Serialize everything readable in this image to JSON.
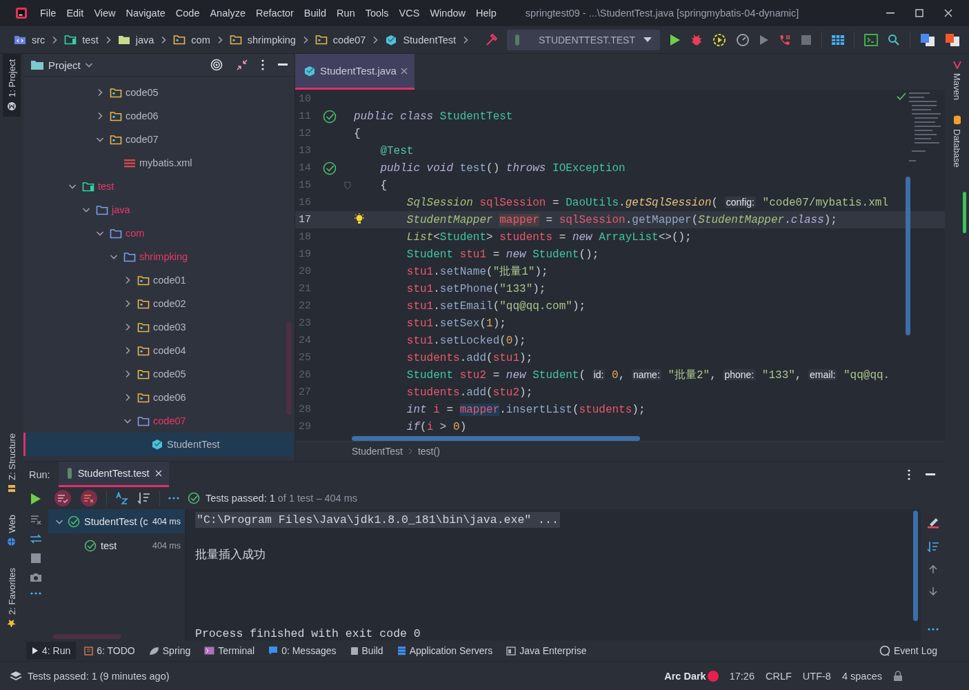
{
  "window": {
    "title": "springtest09 - ...\\StudentTest.java [springmybatis-04-dynamic]"
  },
  "menu": [
    "File",
    "Edit",
    "View",
    "Navigate",
    "Code",
    "Analyze",
    "Refactor",
    "Build",
    "Run",
    "Tools",
    "VCS",
    "Window",
    "Help"
  ],
  "nav": {
    "breadcrumb": [
      {
        "label": "src",
        "kind": "source_root"
      },
      {
        "label": "test",
        "kind": "test_root"
      },
      {
        "label": "java",
        "kind": "java_root"
      },
      {
        "label": "com",
        "kind": "package"
      },
      {
        "label": "shrimpking",
        "kind": "package"
      },
      {
        "label": "code07",
        "kind": "package"
      },
      {
        "label": "StudentTest",
        "kind": "class"
      }
    ],
    "run_config": "STUDENTTEST.TEST"
  },
  "left_stripe": {
    "top": [
      {
        "label": "1: Project",
        "selected": true
      }
    ],
    "bottom": [
      {
        "label": "Z: Structure",
        "selected": false
      },
      {
        "label": "Web",
        "selected": false
      },
      {
        "label": "2: Favorites",
        "selected": false
      }
    ]
  },
  "right_stripe": [
    "Maven",
    "Database"
  ],
  "project": {
    "title": "Project",
    "tree": [
      {
        "children": [
          {
            "children": [
              {
                "children": [
                  {
                    "label": "code05",
                    "kind": "package",
                    "expanded": false,
                    "unversioned": false,
                    "selected": false
                  },
                  {
                    "label": "code06",
                    "kind": "package",
                    "expanded": false,
                    "unversioned": false,
                    "selected": false
                  },
                  {
                    "label": "code07",
                    "kind": "package",
                    "expanded": true,
                    "unversioned": false,
                    "selected": false,
                    "children": [
                      {
                        "label": "mybatis.xml",
                        "kind": "xml",
                        "unversioned": false,
                        "selected": false
                      }
                    ]
                  }
                ]
              }
            ]
          },
          {
            "label": "test",
            "kind": "test_root",
            "expanded": true,
            "unversioned": true,
            "selected": false,
            "children": [
              {
                "label": "java",
                "kind": "folder",
                "expanded": true,
                "unversioned": true,
                "selected": false,
                "children": [
                  {
                    "label": "com",
                    "kind": "folder",
                    "expanded": true,
                    "unversioned": true,
                    "selected": false,
                    "children": [
                      {
                        "label": "shrimpking",
                        "kind": "folder",
                        "expanded": true,
                        "unversioned": true,
                        "selected": false,
                        "children": [
                          {
                            "label": "code01",
                            "kind": "package",
                            "expanded": false,
                            "unversioned": false,
                            "selected": false
                          },
                          {
                            "label": "code02",
                            "kind": "package",
                            "expanded": false,
                            "unversioned": false,
                            "selected": false
                          },
                          {
                            "label": "code03",
                            "kind": "package",
                            "expanded": false,
                            "unversioned": false,
                            "selected": false
                          },
                          {
                            "label": "code04",
                            "kind": "package",
                            "expanded": false,
                            "unversioned": false,
                            "selected": false
                          },
                          {
                            "label": "code05",
                            "kind": "package",
                            "expanded": false,
                            "unversioned": false,
                            "selected": false
                          },
                          {
                            "label": "code06",
                            "kind": "package",
                            "expanded": false,
                            "unversioned": false,
                            "selected": false
                          },
                          {
                            "label": "code07",
                            "kind": "folder",
                            "expanded": true,
                            "unversioned": true,
                            "selected": false,
                            "children": [
                              {
                                "label": "StudentTest",
                                "kind": "class",
                                "unversioned": false,
                                "selected": true
                              }
                            ]
                          }
                        ]
                      }
                    ]
                  }
                ]
              }
            ]
          }
        ]
      }
    ]
  },
  "editor": {
    "tabs": [
      {
        "label": "StudentTest.java",
        "selected": true
      }
    ],
    "lines": [
      {
        "number": "10",
        "kind": "plain",
        "current": false
      },
      {
        "number": "11",
        "kind": "runnable",
        "current": false,
        "tokens": [
          {
            "kind": "kw",
            "text": "public class "
          },
          {
            "kind": "type",
            "text": "StudentTest"
          }
        ]
      },
      {
        "number": "12",
        "kind": "plain",
        "current": false,
        "tokens": [
          {
            "kind": "punct",
            "text": "{"
          }
        ]
      },
      {
        "number": "13",
        "kind": "plain",
        "current": false,
        "tokens": [
          {
            "kind": "annotation",
            "text": "    @Test"
          }
        ]
      },
      {
        "number": "14",
        "kind": "runnable",
        "current": false,
        "tokens": [
          {
            "kind": "kw",
            "text": "    public void "
          },
          {
            "kind": "method",
            "text": "test"
          },
          {
            "kind": "punct",
            "text": "() "
          },
          {
            "kind": "kw",
            "text": "throws "
          },
          {
            "kind": "type",
            "text": "IOException"
          }
        ]
      },
      {
        "number": "15",
        "kind": "foldable",
        "current": false,
        "tokens": [
          {
            "kind": "punct",
            "text": "    {"
          }
        ]
      },
      {
        "number": "16",
        "kind": "plain",
        "current": false,
        "tokens": [
          {
            "kind": "itype",
            "text": "        SqlSession "
          },
          {
            "kind": "var",
            "text": "sqlSession"
          },
          {
            "kind": "punct",
            "text": " = "
          },
          {
            "kind": "type",
            "text": "DaoUtils"
          },
          {
            "kind": "punct",
            "text": "."
          },
          {
            "kind": "static",
            "text": "getSqlSession"
          },
          {
            "kind": "punct",
            "text": "( "
          },
          {
            "kind": "hint",
            "text": "config:"
          },
          {
            "kind": "string",
            "text": " \"code07/mybatis.xml"
          }
        ]
      },
      {
        "number": "17",
        "kind": "intention",
        "current": true,
        "tokens": [
          {
            "kind": "itype",
            "text": "        StudentMapper "
          },
          {
            "kind": "var_write",
            "text": "mapper"
          },
          {
            "kind": "punct",
            "text": " = "
          },
          {
            "kind": "var",
            "text": "sqlSession"
          },
          {
            "kind": "punct",
            "text": "."
          },
          {
            "kind": "method",
            "text": "getMapper"
          },
          {
            "kind": "punct",
            "text": "("
          },
          {
            "kind": "itype",
            "text": "StudentMapper"
          },
          {
            "kind": "punct",
            "text": "."
          },
          {
            "kind": "kw",
            "text": "class"
          },
          {
            "kind": "punct",
            "text": ");"
          }
        ]
      },
      {
        "number": "18",
        "kind": "plain",
        "current": false,
        "tokens": [
          {
            "kind": "itype",
            "text": "        List"
          },
          {
            "kind": "punct",
            "text": "<"
          },
          {
            "kind": "type",
            "text": "Student"
          },
          {
            "kind": "punct",
            "text": "> "
          },
          {
            "kind": "var",
            "text": "students"
          },
          {
            "kind": "punct",
            "text": " = "
          },
          {
            "kind": "kw",
            "text": "new "
          },
          {
            "kind": "type",
            "text": "ArrayList"
          },
          {
            "kind": "punct",
            "text": "<>();"
          }
        ]
      },
      {
        "number": "19",
        "kind": "plain",
        "current": false,
        "tokens": [
          {
            "kind": "type",
            "text": "        Student "
          },
          {
            "kind": "var",
            "text": "stu1"
          },
          {
            "kind": "punct",
            "text": " = "
          },
          {
            "kind": "kw",
            "text": "new "
          },
          {
            "kind": "type",
            "text": "Student"
          },
          {
            "kind": "punct",
            "text": "();"
          }
        ]
      },
      {
        "number": "20",
        "kind": "plain",
        "current": false,
        "tokens": [
          {
            "kind": "var",
            "text": "        stu1"
          },
          {
            "kind": "punct",
            "text": "."
          },
          {
            "kind": "method",
            "text": "setName"
          },
          {
            "kind": "punct",
            "text": "("
          },
          {
            "kind": "string",
            "text": "\"批量1\""
          },
          {
            "kind": "punct",
            "text": ");"
          }
        ]
      },
      {
        "number": "21",
        "kind": "plain",
        "current": false,
        "tokens": [
          {
            "kind": "var",
            "text": "        stu1"
          },
          {
            "kind": "punct",
            "text": "."
          },
          {
            "kind": "method",
            "text": "setPhone"
          },
          {
            "kind": "punct",
            "text": "("
          },
          {
            "kind": "string",
            "text": "\"133\""
          },
          {
            "kind": "punct",
            "text": ");"
          }
        ]
      },
      {
        "number": "22",
        "kind": "plain",
        "current": false,
        "tokens": [
          {
            "kind": "var",
            "text": "        stu1"
          },
          {
            "kind": "punct",
            "text": "."
          },
          {
            "kind": "method",
            "text": "setEmail"
          },
          {
            "kind": "punct",
            "text": "("
          },
          {
            "kind": "string",
            "text": "\"qq@qq.com\""
          },
          {
            "kind": "punct",
            "text": ");"
          }
        ]
      },
      {
        "number": "23",
        "kind": "plain",
        "current": false,
        "tokens": [
          {
            "kind": "var",
            "text": "        stu1"
          },
          {
            "kind": "punct",
            "text": "."
          },
          {
            "kind": "method",
            "text": "setSex"
          },
          {
            "kind": "punct",
            "text": "("
          },
          {
            "kind": "number",
            "text": "1"
          },
          {
            "kind": "punct",
            "text": ");"
          }
        ]
      },
      {
        "number": "24",
        "kind": "plain",
        "current": false,
        "tokens": [
          {
            "kind": "var",
            "text": "        stu1"
          },
          {
            "kind": "punct",
            "text": "."
          },
          {
            "kind": "method",
            "text": "setLocked"
          },
          {
            "kind": "punct",
            "text": "("
          },
          {
            "kind": "number",
            "text": "0"
          },
          {
            "kind": "punct",
            "text": ");"
          }
        ]
      },
      {
        "number": "25",
        "kind": "plain",
        "current": false,
        "tokens": [
          {
            "kind": "var",
            "text": "        students"
          },
          {
            "kind": "punct",
            "text": "."
          },
          {
            "kind": "method",
            "text": "add"
          },
          {
            "kind": "punct",
            "text": "("
          },
          {
            "kind": "var",
            "text": "stu1"
          },
          {
            "kind": "punct",
            "text": ");"
          }
        ]
      },
      {
        "number": "26",
        "kind": "plain",
        "current": false,
        "tokens": [
          {
            "kind": "type",
            "text": "        Student "
          },
          {
            "kind": "var",
            "text": "stu2"
          },
          {
            "kind": "punct",
            "text": " = "
          },
          {
            "kind": "kw",
            "text": "new "
          },
          {
            "kind": "type",
            "text": "Student"
          },
          {
            "kind": "punct",
            "text": "( "
          },
          {
            "kind": "hint",
            "text": "id:"
          },
          {
            "kind": "number",
            "text": " 0"
          },
          {
            "kind": "punct",
            "text": ", "
          },
          {
            "kind": "hint",
            "text": "name:"
          },
          {
            "kind": "string",
            "text": " \"批量2\""
          },
          {
            "kind": "punct",
            "text": ", "
          },
          {
            "kind": "hint",
            "text": "phone:"
          },
          {
            "kind": "string",
            "text": " \"133\""
          },
          {
            "kind": "punct",
            "text": ", "
          },
          {
            "kind": "hint",
            "text": "email:"
          },
          {
            "kind": "string",
            "text": " \"qq@qq."
          }
        ]
      },
      {
        "number": "27",
        "kind": "plain",
        "current": false,
        "tokens": [
          {
            "kind": "var",
            "text": "        students"
          },
          {
            "kind": "punct",
            "text": "."
          },
          {
            "kind": "method",
            "text": "add"
          },
          {
            "kind": "punct",
            "text": "("
          },
          {
            "kind": "var",
            "text": "stu2"
          },
          {
            "kind": "punct",
            "text": ");"
          }
        ]
      },
      {
        "number": "28",
        "kind": "plain",
        "current": false,
        "tokens": [
          {
            "kind": "kw",
            "text": "        int "
          },
          {
            "kind": "var",
            "text": "i"
          },
          {
            "kind": "punct",
            "text": " = "
          },
          {
            "kind": "var_read",
            "text": "mapper"
          },
          {
            "kind": "punct",
            "text": "."
          },
          {
            "kind": "method",
            "text": "insertList"
          },
          {
            "kind": "punct",
            "text": "("
          },
          {
            "kind": "var",
            "text": "students"
          },
          {
            "kind": "punct",
            "text": ");"
          }
        ]
      },
      {
        "number": "29",
        "kind": "plain",
        "current": false,
        "tokens": [
          {
            "kind": "kw",
            "text": "        if"
          },
          {
            "kind": "punct",
            "text": "("
          },
          {
            "kind": "var",
            "text": "i"
          },
          {
            "kind": "punct",
            "text": " > "
          },
          {
            "kind": "number",
            "text": "0"
          },
          {
            "kind": "punct",
            "text": ")"
          }
        ]
      }
    ],
    "breadcrumb": [
      "StudentTest",
      "test()"
    ]
  },
  "run": {
    "label": "Run:",
    "tab": {
      "label": "StudentTest.test",
      "selected": true
    },
    "status": "Tests passed: 1",
    "status_detail": "of 1 test – 404 ms",
    "tests": [
      {
        "label": "StudentTest (c",
        "duration": "404 ms",
        "selected": true,
        "children": [
          {
            "label": "test",
            "duration": "404 ms",
            "selected": false
          }
        ]
      }
    ],
    "console": [
      {
        "kind": "command",
        "text": "\"C:\\Program Files\\Java\\jdk1.8.0_181\\bin\\java.exe\" ..."
      },
      {
        "kind": "output",
        "text": "批量插入成功"
      },
      {
        "kind": "exit",
        "text": "Process finished with exit code 0"
      }
    ]
  },
  "tool_windows": [
    {
      "label": "4: Run",
      "kind": "run",
      "selected": true
    },
    {
      "label": "6: TODO",
      "kind": "todo",
      "selected": false
    },
    {
      "label": "Spring",
      "kind": "spring",
      "selected": false
    },
    {
      "label": "Terminal",
      "kind": "terminal",
      "selected": false
    },
    {
      "label": "0: Messages",
      "kind": "messages",
      "selected": false
    },
    {
      "label": "Build",
      "kind": "build",
      "selected": false
    },
    {
      "label": "Application Servers",
      "kind": "servers",
      "selected": false
    },
    {
      "label": "Java Enterprise",
      "kind": "enterprise",
      "selected": false
    }
  ],
  "event_log": "Event Log",
  "status_bar": {
    "message": "Tests passed: 1 (9 minutes ago)",
    "theme": "Arc Dark",
    "position": "17:26",
    "line_separator": "CRLF",
    "encoding": "UTF-8",
    "indent": "4 spaces"
  }
}
